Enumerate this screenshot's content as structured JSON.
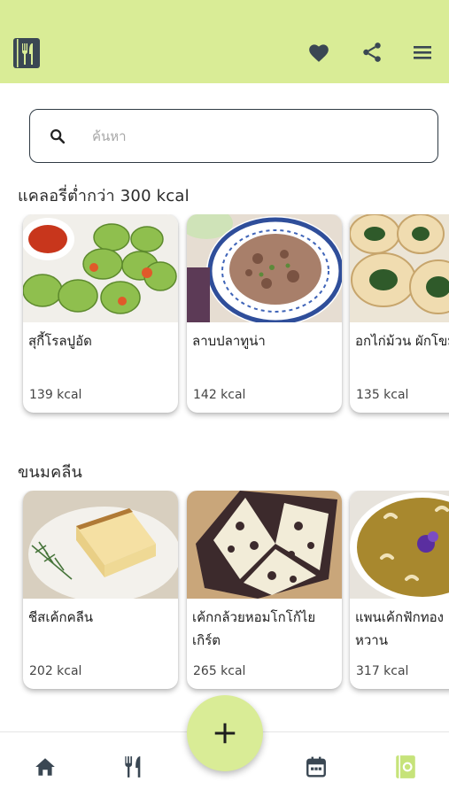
{
  "header": {
    "logo_icon": "menu-book-icon",
    "actions": [
      "heart-icon",
      "share-icon",
      "hamburger-menu-icon"
    ],
    "background": "#d9ec96",
    "icon_color": "#3a4753"
  },
  "search": {
    "placeholder": "ค้นหา",
    "value": ""
  },
  "sections": [
    {
      "title": "แคลอรี่ต่ำกว่า 300 kcal",
      "items": [
        {
          "name": "สุกี้โรลปูอัด",
          "kcal": "139 kcal"
        },
        {
          "name": "ลาบปลาทูน่า",
          "kcal": "142 kcal"
        },
        {
          "name": "อกไก่ม้วน ผักโขม",
          "kcal": "135 kcal"
        }
      ]
    },
    {
      "title": "ขนมคลีน",
      "items": [
        {
          "name": "ชีสเค้กคลีน",
          "kcal": "202 kcal"
        },
        {
          "name": "เค้กกล้วยหอมโกโก้ไยเกิร์ต",
          "kcal": "265 kcal"
        },
        {
          "name": "แพนเค้กฟักทองหวาน",
          "kcal": "317 kcal"
        }
      ]
    }
  ],
  "bottom_nav": {
    "items": [
      "home-icon",
      "restaurant-icon",
      "add-icon",
      "calendar-icon",
      "recipe-book-icon"
    ],
    "active": "recipe-book-icon",
    "active_color": "#c6e37a",
    "inactive_color": "#3a4753"
  }
}
